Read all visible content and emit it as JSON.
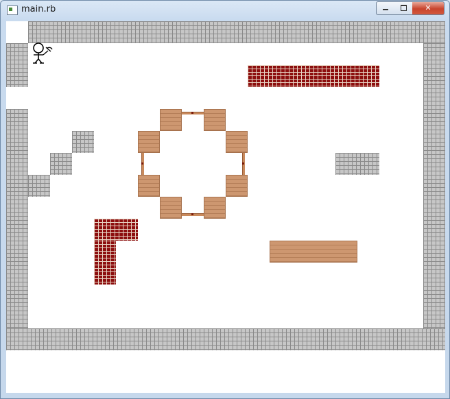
{
  "window": {
    "title": "main.rb",
    "buttons": {
      "close_glyph": "✕"
    }
  },
  "icons": {
    "app": "ruby-window-icon",
    "player": "stick-figure-with-pickaxe"
  },
  "colors": {
    "stone": "#c7c7c7",
    "brick": "#8c0e0e",
    "wood": "#cd9770",
    "background": "#ffffff"
  },
  "legend_tiles": [
    "stone-wall",
    "red-brick",
    "wood-plank",
    "rope-link"
  ]
}
